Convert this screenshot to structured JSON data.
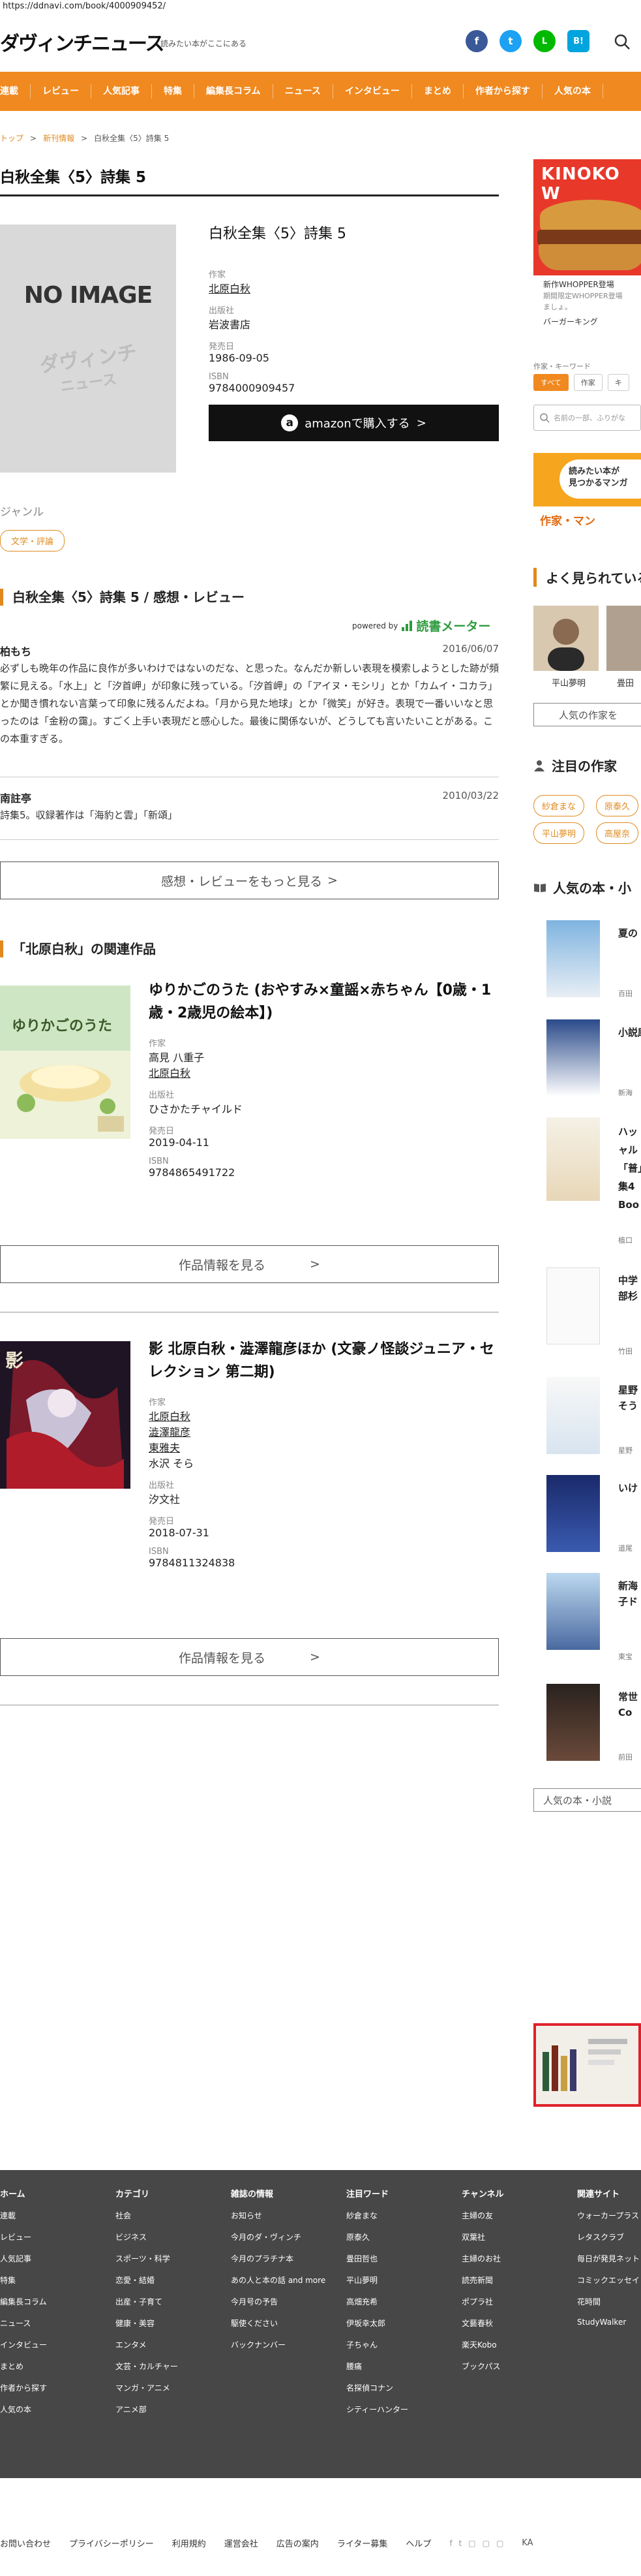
{
  "url": "https://ddnavi.com/book/4000909452/",
  "header": {
    "logo": "ダヴィンチニュース",
    "tagline": "読みたい本がここにある",
    "social": [
      {
        "name": "facebook",
        "glyph": "f",
        "color": "#3b5998"
      },
      {
        "name": "twitter",
        "glyph": "t",
        "color": "#1da1f2"
      },
      {
        "name": "line",
        "glyph": "L",
        "color": "#00b900"
      },
      {
        "name": "hatena",
        "glyph": "B!",
        "color": "#00a4de"
      }
    ]
  },
  "nav": [
    "連載",
    "レビュー",
    "人気記事",
    "特集",
    "編集長コラム",
    "ニュース",
    "インタビュー",
    "まとめ",
    "作者から探す",
    "人気の本"
  ],
  "breadcrumb": [
    "トップ",
    "新刊情報",
    "白秋全集〈5〉詩集 5"
  ],
  "book": {
    "page_title": "白秋全集〈5〉詩集 5",
    "title": "白秋全集〈5〉詩集 5",
    "cover_text": "NO IMAGE",
    "cover_logo_1": "ダヴィンチ",
    "cover_logo_2": "ニュース",
    "author_label": "作家",
    "author": "北原白秋",
    "publisher_label": "出版社",
    "publisher": "岩波書店",
    "date_label": "発売日",
    "date": "1986-09-05",
    "isbn_label": "ISBN",
    "isbn": "9784000909457",
    "amazon_label": "amazonで購入する",
    "genre_label": "ジャンル",
    "genre": "文学・評論"
  },
  "reviews_section": {
    "title": "白秋全集〈5〉詩集 5 / 感想・レビュー",
    "powered_by": "powered by",
    "provider": "読書メーター",
    "items": [
      {
        "name": "柏もち",
        "date": "2016/06/07",
        "text": "必ずしも晩年の作品に良作が多いわけではないのだな、と思った。なんだか新しい表現を模索しようとした跡が頻繁に見える。「水上」と「汐首岬」が印象に残っている。「汐首岬」の「アイヌ・モシリ」とか「カムイ・コカラ」とか聞き慣れない言葉って印象に残るんだよね。「月から見た地球」とか「微笑」が好き。表現で一番いいなと思ったのは「金粉の靄」。すごく上手い表現だと感心した。最後に関係ないが、どうしても言いたいことがある。この本重すぎる。"
      },
      {
        "name": "南註亭",
        "date": "2010/03/22",
        "text": "詩集5。収録著作は「海豹と雲」「新頌」"
      }
    ],
    "more_label": "感想・レビューをもっと見る"
  },
  "related_section": {
    "title": "「北原白秋」の関連作品",
    "items": [
      {
        "title": "ゆりかごのうた (おやすみ×童謡×赤ちゃん【0歳・1歳・2歳児の絵本】)",
        "cover_text": "ゆりかごのうた",
        "author_label": "作家",
        "authors": [
          "高見 八重子",
          "北原白秋"
        ],
        "publisher_label": "出版社",
        "publisher": "ひさかたチャイルド",
        "date_label": "発売日",
        "date": "2019-04-11",
        "isbn_label": "ISBN",
        "isbn": "9784865491722",
        "button_label": "作品情報を見る"
      },
      {
        "title": "影 北原白秋・澁澤龍彦ほか (文豪ノ怪談ジュニア・セレクション 第二期)",
        "cover_text": "影",
        "author_label": "作家",
        "authors": [
          "北原白秋",
          "澁澤龍彦",
          "東雅夫",
          "水沢 そら"
        ],
        "publisher_label": "出版社",
        "publisher": "汐文社",
        "date_label": "発売日",
        "date": "2018-07-31",
        "isbn_label": "ISBN",
        "isbn": "9784811324838",
        "button_label": "作品情報を見る"
      }
    ]
  },
  "sidebar": {
    "ad_top": {
      "brand": "KINOKO W",
      "caption": "新作WHOPPER登場",
      "sub": "期間限定WHOPPER登場",
      "sub2": "ましょ。",
      "advertiser": "バーガーキング"
    },
    "keyword_label": "作家・キーワード",
    "filters": [
      "すべて",
      "作家",
      "キ"
    ],
    "search_placeholder": "名前の一部、ふりがな",
    "ad_manga": {
      "bubble_1": "読みたい本が",
      "bubble_2": "見つかるマンガ",
      "bar": "作家・マン"
    },
    "popular_authors_title": "よく見られている",
    "popular_authors": [
      "平山夢明",
      "畳田"
    ],
    "popular_authors_more": "人気の作家を",
    "watched_title": "注目の作家",
    "watched_tags": [
      "紗倉まな",
      "原泰久",
      "平山夢明",
      "高屋奈"
    ],
    "ranking_title": "人気の本・小",
    "ranking": [
      {
        "title": "夏の",
        "author": "百田"
      },
      {
        "title": "小説庫)",
        "author": "新海"
      },
      {
        "title": "ハッャル「普」集4 Boo",
        "author": "植口"
      },
      {
        "title": "中学部杉",
        "author": "竹田"
      },
      {
        "title": "星野そう",
        "author": "星野"
      },
      {
        "title": "いけ",
        "author": "道尾"
      },
      {
        "title": "新海子ド",
        "author": "東宝"
      },
      {
        "title": "常世Co",
        "author": "前田"
      }
    ],
    "ranking_more": "人気の本・小説"
  },
  "footer": {
    "columns": [
      {
        "head": "ホーム",
        "items": [
          "連載",
          "レビュー",
          "人気記事",
          "特集",
          "編集長コラム",
          "ニュース",
          "インタビュー",
          "まとめ",
          "作者から探す",
          "人気の本"
        ]
      },
      {
        "head": "カテゴリ",
        "items": [
          "社会",
          "ビジネス",
          "スポーツ・科学",
          "恋愛・結婚",
          "出産・子育て",
          "健康・美容",
          "エンタメ",
          "文芸・カルチャー",
          "マンガ・アニメ",
          "アニメ部"
        ]
      },
      {
        "head": "雑誌の情報",
        "items": [
          "お知らせ",
          "今月のダ・ヴィンチ",
          "今月のプラチナ本",
          "あの人と本の話 and more",
          "今月号の予告",
          "駆使ください",
          "バックナンバー"
        ]
      },
      {
        "head": "注目ワード",
        "items": [
          "紗倉まな",
          "原泰久",
          "畳田哲也",
          "平山夢明",
          "高畑充希",
          "伊坂幸太郎",
          "子ちゃん",
          "腰痛",
          "名探偵コナン",
          "シティーハンター"
        ]
      },
      {
        "head": "チャンネル",
        "items": [
          "主婦の友",
          "双葉社",
          "主婦のお社",
          "読売新聞",
          "ポプラ社",
          "文藝春秋",
          "楽天Kobo",
          "ブックパス"
        ]
      },
      {
        "head": "関連サイト",
        "items": [
          "ウォーカープラス",
          "レタスクラブ",
          "毎日が発見ネット",
          "コミックエッセイ",
          "花時間",
          "StudyWalker"
        ]
      }
    ],
    "bottom_links": [
      "お問い合わせ",
      "プライバシーポリシー",
      "利用規約",
      "運営会社",
      "広告の案内",
      "ライター募集",
      "ヘルプ"
    ],
    "corner_text": "KA"
  }
}
